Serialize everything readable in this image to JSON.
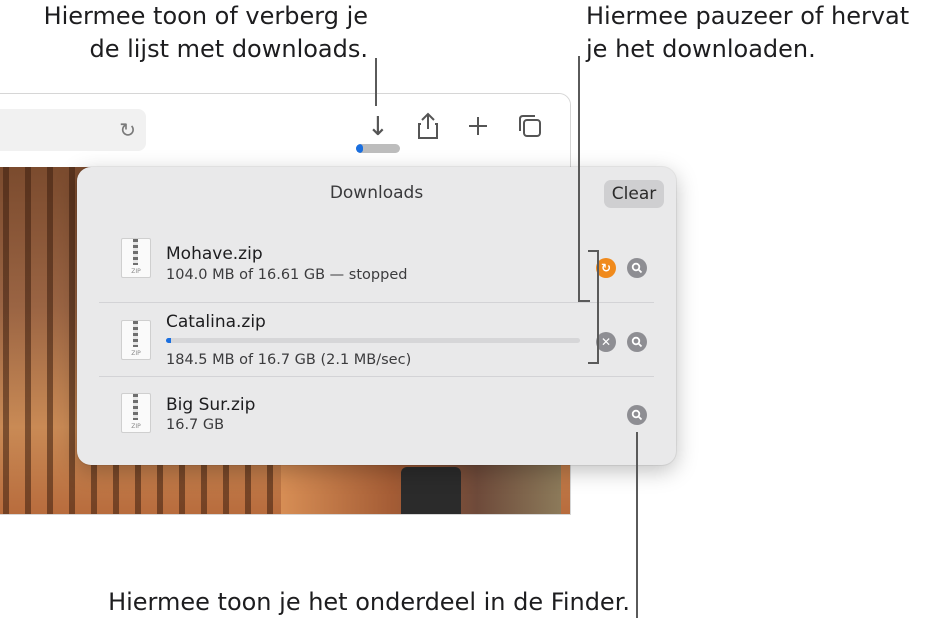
{
  "callouts": {
    "toggle_list_line1": "Hiermee toon of verberg je",
    "toggle_list_line2": "de lijst met downloads.",
    "pause_resume_line1": "Hiermee pauzeer of hervat",
    "pause_resume_line2": "je het downloaden.",
    "show_in_finder": "Hiermee toon je het onderdeel in de Finder."
  },
  "toolbar": {
    "icons": [
      "reload-icon",
      "download-icon",
      "share-icon",
      "new-tab-icon",
      "tab-overview-icon"
    ],
    "download_progress_fraction": 0.15
  },
  "popover": {
    "title": "Downloads",
    "clear_label": "Clear",
    "items": [
      {
        "name": "Mohave.zip",
        "status": "104.0 MB of 16.61 GB — stopped",
        "icon_label": "ZIP",
        "state": "stopped"
      },
      {
        "name": "Catalina.zip",
        "status": "184.5 MB of 16.7 GB (2.1 MB/sec)",
        "icon_label": "ZIP",
        "state": "downloading",
        "progress_fraction": 0.011
      },
      {
        "name": "Big Sur.zip",
        "status": "16.7 GB",
        "icon_label": "ZIP",
        "state": "done"
      }
    ]
  },
  "colors": {
    "accent": "#1a6fe0",
    "resume": "#f08a1c",
    "control_gray": "#8e8e93"
  }
}
